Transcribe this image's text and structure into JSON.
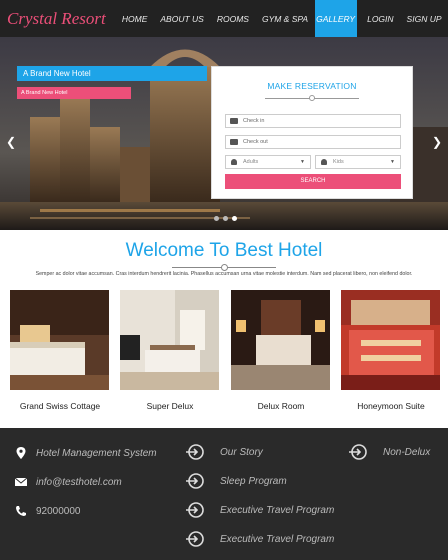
{
  "navbar": {
    "brand": "Crystal Resort",
    "items": [
      {
        "label": "HOME"
      },
      {
        "label": "ABOUT US"
      },
      {
        "label": "ROOMS"
      },
      {
        "label": "GYM & SPA"
      },
      {
        "label": "GALLERY",
        "active": true
      },
      {
        "label": "LOGIN"
      },
      {
        "label": "SIGN UP"
      }
    ]
  },
  "hero": {
    "caption_title": "A Brand New Hotel",
    "caption_sub": "A Brand New Hotel",
    "prev_icon": "chevron-left-icon",
    "next_icon": "chevron-right-icon",
    "slides": 3,
    "active_slide": 3
  },
  "reservation": {
    "title": "MAKE RESERVATION",
    "checkin_placeholder": "Check in",
    "checkout_placeholder": "Check out",
    "adults_value": "Adults",
    "kids_value": "Kids",
    "search_label": "SEARCH"
  },
  "welcome": {
    "title": "Welcome To Best Hotel",
    "text": "Semper ac dolor vitae accumsan. Cras interdum hendrerit lacinia. Phasellus accumsan urna vitae molestie interdum. Nam sed placerat libero, non eleifend dolor."
  },
  "rooms": [
    {
      "name": "Grand Swiss Cottage"
    },
    {
      "name": "Super Delux"
    },
    {
      "name": "Delux Room"
    },
    {
      "name": "Honeymoon Suite"
    }
  ],
  "footer": {
    "contact": {
      "name": "Hotel Management System",
      "email": "info@testhotel.com",
      "phone": "92000000"
    },
    "links_col1": [
      "Our Story",
      "Sleep Program",
      "Executive Travel Program",
      "Executive Travel Program"
    ],
    "links_col2": [
      "Non-Delux"
    ]
  },
  "colors": {
    "accent_blue": "#1ea4e8",
    "accent_pink": "#ec4f79",
    "nav_bg": "#222222",
    "footer_bg": "#2a2a2a"
  }
}
